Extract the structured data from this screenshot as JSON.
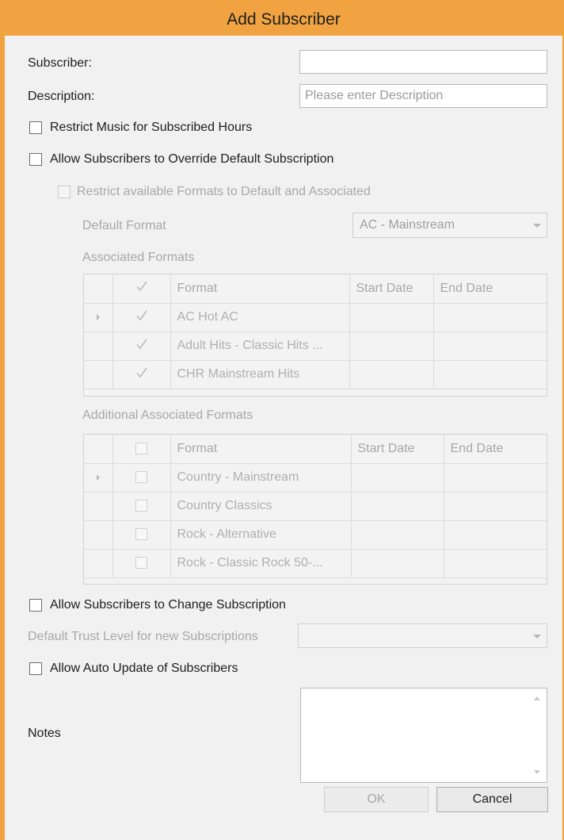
{
  "window": {
    "title": "Add Subscriber"
  },
  "form": {
    "subscriber_label": "Subscriber:",
    "subscriber_value": "",
    "description_label": "Description:",
    "description_value": "",
    "description_placeholder": "Please enter Description",
    "restrict_music_label": "Restrict Music for Subscribed Hours",
    "allow_override_label": "Allow Subscribers to Override Default Subscription",
    "restrict_formats_label": "Restrict available Formats to Default and Associated",
    "default_format_label": "Default Format",
    "default_format_value": "AC - Mainstream",
    "associated_formats_label": "Associated Formats",
    "additional_formats_label": "Additional Associated Formats",
    "allow_change_label": "Allow Subscribers to Change Subscription",
    "trust_level_label": "Default Trust Level for new Subscriptions",
    "trust_level_value": "",
    "auto_update_label": "Allow Auto Update of Subscribers",
    "notes_label": "Notes"
  },
  "associated_grid": {
    "headers": [
      "Format",
      "Start Date",
      "End Date"
    ],
    "rows": [
      {
        "format": "AC Hot AC",
        "start": "",
        "end": "",
        "checked": true
      },
      {
        "format": "Adult Hits - Classic Hits ...",
        "start": "",
        "end": "",
        "checked": true
      },
      {
        "format": "CHR Mainstream Hits",
        "start": "",
        "end": "",
        "checked": true
      }
    ]
  },
  "additional_grid": {
    "headers": [
      "Format",
      "Start Date",
      "End Date"
    ],
    "rows": [
      {
        "format": "Country - Mainstream",
        "start": "",
        "end": "",
        "checked": false
      },
      {
        "format": "Country Classics",
        "start": "",
        "end": "",
        "checked": false
      },
      {
        "format": "Rock - Alternative",
        "start": "",
        "end": "",
        "checked": false
      },
      {
        "format": "Rock - Classic Rock 50-...",
        "start": "",
        "end": "",
        "checked": false
      }
    ]
  },
  "buttons": {
    "ok_label": "OK",
    "cancel_label": "Cancel"
  },
  "colors": {
    "title_bar": "#f0a340",
    "dialog_bg": "#f1f1f1"
  }
}
